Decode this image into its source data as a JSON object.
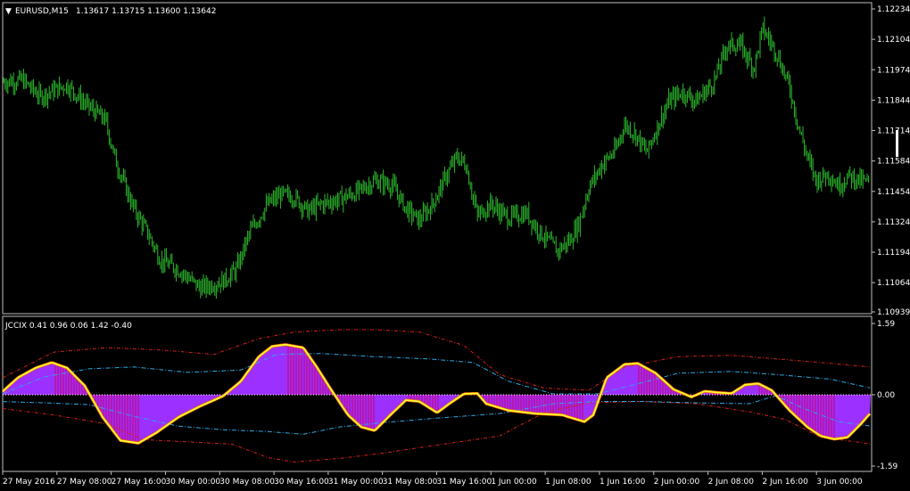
{
  "main_header": {
    "symbol": "EURUSD,M15",
    "values": "1.13617 1.13715 1.13600 1.13642",
    "marker": "▼"
  },
  "indicator_header": {
    "label": "JCCIX 0.41 0.96 0.06 1.42 -0.40"
  },
  "colors": {
    "background": "#000000",
    "frame": "#c0c0c0",
    "candles": "#2db82d",
    "histogram": "#9b30ff",
    "histogram_bars": "#cc0066",
    "signal_line": "#ffff33",
    "signal_edge": "#ff6600",
    "band_outer": "#d42020",
    "band_inner": "#2fa8e8",
    "zero_line": "#ffffff",
    "text": "#ffffff"
  },
  "chart_data": [
    {
      "type": "candlestick",
      "symbol": "EURUSD",
      "timeframe": "M15",
      "ylim": [
        1.10939,
        1.12234
      ],
      "yticks": [
        "1.12234",
        "1.12104",
        "1.11974",
        "1.11844",
        "1.11714",
        "1.11584",
        "1.11454",
        "1.11324",
        "1.11194",
        "1.11064",
        "1.10939"
      ],
      "xticks": [
        "27 May 2016",
        "27 May 08:00",
        "27 May 16:00",
        "30 May 00:00",
        "30 May 08:00",
        "30 May 16:00",
        "31 May 00:00",
        "31 May 08:00",
        "31 May 16:00",
        "1 Jun 00:00",
        "1 Jun 08:00",
        "1 Jun 16:00",
        "2 Jun 00:00",
        "2 Jun 08:00",
        "2 Jun 16:00",
        "3 Jun 00:00"
      ],
      "close_trace": [
        [
          0,
          1.1192
        ],
        [
          25,
          1.1193
        ],
        [
          45,
          1.1186
        ],
        [
          75,
          1.1191
        ],
        [
          95,
          1.1183
        ],
        [
          118,
          1.1176
        ],
        [
          130,
          1.1158
        ],
        [
          150,
          1.1138
        ],
        [
          165,
          1.1128
        ],
        [
          180,
          1.1116
        ],
        [
          200,
          1.1112
        ],
        [
          225,
          1.1104
        ],
        [
          250,
          1.1107
        ],
        [
          265,
          1.1112
        ],
        [
          280,
          1.1128
        ],
        [
          300,
          1.114
        ],
        [
          315,
          1.1144
        ],
        [
          330,
          1.1143
        ],
        [
          345,
          1.1137
        ],
        [
          360,
          1.114
        ],
        [
          380,
          1.1142
        ],
        [
          400,
          1.1145
        ],
        [
          420,
          1.115
        ],
        [
          440,
          1.1148
        ],
        [
          455,
          1.1138
        ],
        [
          470,
          1.1133
        ],
        [
          485,
          1.114
        ],
        [
          500,
          1.1152
        ],
        [
          512,
          1.116
        ],
        [
          522,
          1.1157
        ],
        [
          535,
          1.1135
        ],
        [
          550,
          1.114
        ],
        [
          570,
          1.1134
        ],
        [
          590,
          1.1136
        ],
        [
          605,
          1.1128
        ],
        [
          625,
          1.112
        ],
        [
          640,
          1.1125
        ],
        [
          650,
          1.1133
        ],
        [
          660,
          1.1147
        ],
        [
          675,
          1.1157
        ],
        [
          690,
          1.1163
        ],
        [
          700,
          1.1174
        ],
        [
          712,
          1.117
        ],
        [
          725,
          1.1162
        ],
        [
          738,
          1.1174
        ],
        [
          750,
          1.1184
        ],
        [
          765,
          1.1188
        ],
        [
          780,
          1.1184
        ],
        [
          800,
          1.1192
        ],
        [
          815,
          1.1208
        ],
        [
          830,
          1.1208
        ],
        [
          845,
          1.1198
        ],
        [
          855,
          1.1215
        ],
        [
          870,
          1.1205
        ],
        [
          885,
          1.119
        ],
        [
          895,
          1.1173
        ],
        [
          905,
          1.116
        ],
        [
          915,
          1.115
        ],
        [
          928,
          1.1153
        ],
        [
          940,
          1.1148
        ],
        [
          952,
          1.1152
        ],
        [
          965,
          1.115
        ],
        [
          976,
          1.1149
        ]
      ]
    },
    {
      "type": "line",
      "name": "JCCIX",
      "ylim": [
        -1.59,
        1.59
      ],
      "yticks": [
        "1.59",
        "0.00",
        "-1.59"
      ],
      "series": [
        {
          "role": "histogram_and_signal",
          "points": [
            [
              0,
              0.02
            ],
            [
              20,
              0.38
            ],
            [
              40,
              0.6
            ],
            [
              58,
              0.72
            ],
            [
              75,
              0.6
            ],
            [
              95,
              0.2
            ],
            [
              115,
              -0.5
            ],
            [
              135,
              -1.02
            ],
            [
              155,
              -1.08
            ],
            [
              175,
              -0.85
            ],
            [
              200,
              -0.5
            ],
            [
              225,
              -0.25
            ],
            [
              250,
              -0.03
            ],
            [
              270,
              0.3
            ],
            [
              290,
              0.85
            ],
            [
              305,
              1.08
            ],
            [
              320,
              1.12
            ],
            [
              340,
              1.05
            ],
            [
              355,
              0.62
            ],
            [
              370,
              0.15
            ],
            [
              390,
              -0.45
            ],
            [
              405,
              -0.72
            ],
            [
              420,
              -0.8
            ],
            [
              435,
              -0.5
            ],
            [
              455,
              -0.12
            ],
            [
              470,
              -0.15
            ],
            [
              490,
              -0.4
            ],
            [
              505,
              -0.18
            ],
            [
              520,
              0.02
            ],
            [
              535,
              0.03
            ],
            [
              545,
              -0.2
            ],
            [
              570,
              -0.35
            ],
            [
              600,
              -0.42
            ],
            [
              630,
              -0.45
            ],
            [
              655,
              -0.6
            ],
            [
              665,
              -0.45
            ],
            [
              680,
              0.38
            ],
            [
              700,
              0.68
            ],
            [
              715,
              0.7
            ],
            [
              735,
              0.48
            ],
            [
              755,
              0.12
            ],
            [
              775,
              -0.05
            ],
            [
              790,
              0.08
            ],
            [
              805,
              0.05
            ],
            [
              820,
              0.03
            ],
            [
              835,
              0.22
            ],
            [
              850,
              0.25
            ],
            [
              865,
              0.1
            ],
            [
              885,
              -0.35
            ],
            [
              905,
              -0.72
            ],
            [
              920,
              -0.92
            ],
            [
              935,
              -0.99
            ],
            [
              950,
              -0.95
            ],
            [
              965,
              -0.65
            ],
            [
              976,
              -0.4
            ]
          ]
        },
        {
          "role": "outer_band_upper",
          "points": [
            [
              0,
              0.35
            ],
            [
              60,
              0.95
            ],
            [
              120,
              1.05
            ],
            [
              180,
              1.0
            ],
            [
              240,
              0.9
            ],
            [
              290,
              1.25
            ],
            [
              330,
              1.4
            ],
            [
              380,
              1.45
            ],
            [
              420,
              1.45
            ],
            [
              470,
              1.4
            ],
            [
              520,
              1.1
            ],
            [
              560,
              0.45
            ],
            [
              610,
              0.15
            ],
            [
              660,
              0.1
            ],
            [
              700,
              0.62
            ],
            [
              760,
              0.85
            ],
            [
              820,
              0.88
            ],
            [
              870,
              0.8
            ],
            [
              920,
              0.72
            ],
            [
              976,
              0.62
            ]
          ]
        },
        {
          "role": "outer_band_lower",
          "points": [
            [
              0,
              -0.3
            ],
            [
              60,
              -0.45
            ],
            [
              120,
              -0.65
            ],
            [
              160,
              -1.0
            ],
            [
              210,
              -1.05
            ],
            [
              260,
              -1.1
            ],
            [
              300,
              -1.4
            ],
            [
              330,
              -1.5
            ],
            [
              380,
              -1.42
            ],
            [
              430,
              -1.3
            ],
            [
              490,
              -1.12
            ],
            [
              560,
              -0.92
            ],
            [
              610,
              -0.4
            ],
            [
              660,
              -0.18
            ],
            [
              720,
              -0.15
            ],
            [
              780,
              -0.2
            ],
            [
              840,
              -0.38
            ],
            [
              880,
              -0.55
            ],
            [
              920,
              -0.95
            ],
            [
              960,
              -1.05
            ],
            [
              976,
              -1.1
            ]
          ]
        },
        {
          "role": "inner_band_upper",
          "points": [
            [
              0,
              0.0
            ],
            [
              50,
              0.4
            ],
            [
              100,
              0.58
            ],
            [
              150,
              0.62
            ],
            [
              210,
              0.5
            ],
            [
              270,
              0.55
            ],
            [
              310,
              0.9
            ],
            [
              360,
              0.92
            ],
            [
              420,
              0.85
            ],
            [
              480,
              0.8
            ],
            [
              530,
              0.72
            ],
            [
              570,
              0.3
            ],
            [
              620,
              0.02
            ],
            [
              670,
              0.02
            ],
            [
              710,
              0.22
            ],
            [
              760,
              0.48
            ],
            [
              820,
              0.52
            ],
            [
              870,
              0.45
            ],
            [
              930,
              0.35
            ],
            [
              976,
              0.15
            ]
          ]
        },
        {
          "role": "inner_band_lower",
          "points": [
            [
              0,
              -0.15
            ],
            [
              50,
              -0.18
            ],
            [
              100,
              -0.22
            ],
            [
              150,
              -0.48
            ],
            [
              200,
              -0.7
            ],
            [
              250,
              -0.78
            ],
            [
              300,
              -0.82
            ],
            [
              340,
              -0.88
            ],
            [
              380,
              -0.72
            ],
            [
              430,
              -0.62
            ],
            [
              490,
              -0.52
            ],
            [
              560,
              -0.42
            ],
            [
              620,
              -0.2
            ],
            [
              670,
              -0.15
            ],
            [
              720,
              -0.15
            ],
            [
              780,
              -0.18
            ],
            [
              840,
              -0.2
            ],
            [
              870,
              -0.02
            ],
            [
              900,
              -0.3
            ],
            [
              940,
              -0.6
            ],
            [
              976,
              -0.7
            ]
          ]
        }
      ]
    }
  ]
}
